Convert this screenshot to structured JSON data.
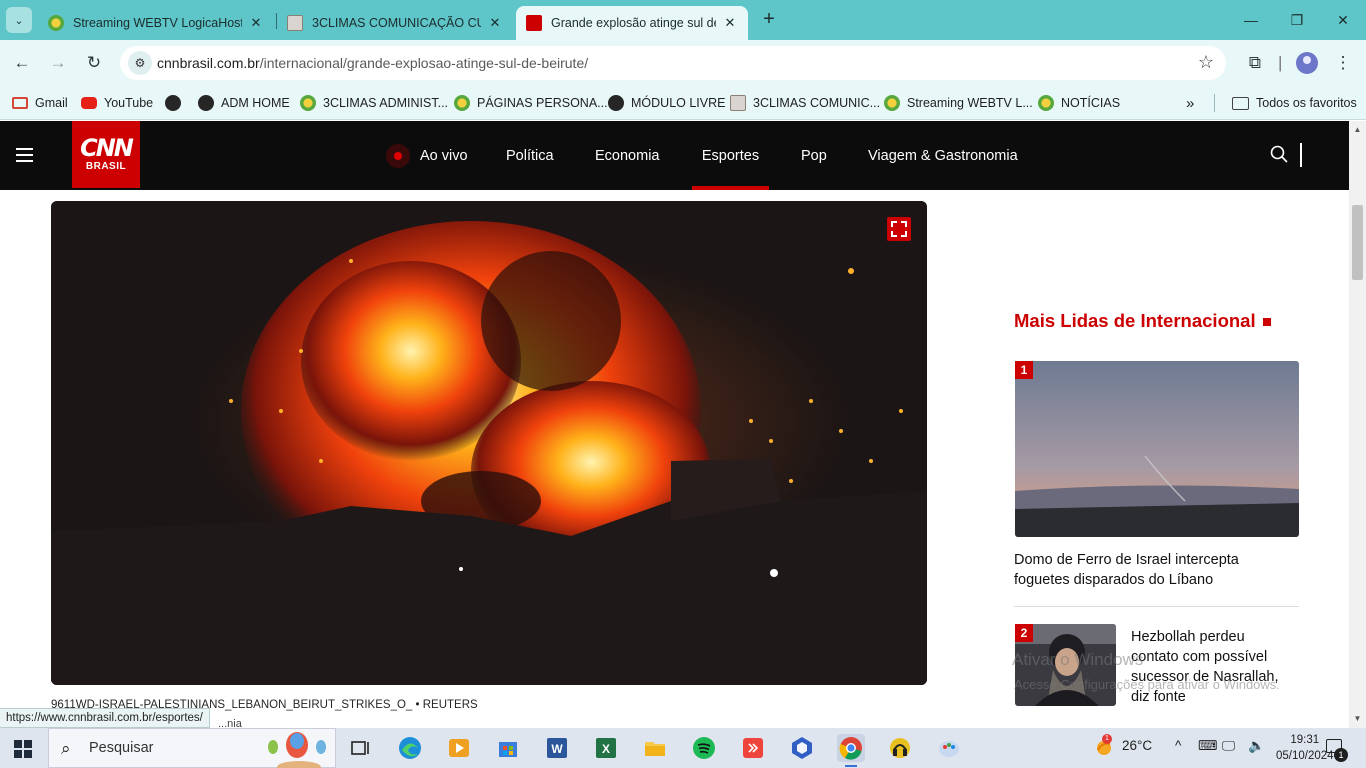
{
  "browser": {
    "tabs": [
      {
        "title": "Streaming WEBTV LogicaHost - ",
        "active": false
      },
      {
        "title": "3CLIMAS COMUNICAÇÃO CULT",
        "active": false
      },
      {
        "title": "Grande explosão atinge sul de ",
        "active": true
      }
    ],
    "address": {
      "domain": "cnnbrasil.com.br",
      "path": "/internacional/grande-explosao-atinge-sul-de-beirute/"
    },
    "bookmarks": [
      {
        "label": "Gmail",
        "icon": "gmail-icon"
      },
      {
        "label": "YouTube",
        "icon": "youtube-icon"
      },
      {
        "label": "",
        "icon": "globe-icon"
      },
      {
        "label": "ADM HOME",
        "icon": "globe-icon"
      },
      {
        "label": "3CLIMAS ADMINIST...",
        "icon": "sunflower-icon"
      },
      {
        "label": "PÁGINAS PERSONA...",
        "icon": "sunflower-icon"
      },
      {
        "label": "MÓDULO LIVRE",
        "icon": "globe-icon"
      },
      {
        "label": "3CLIMAS COMUNIC...",
        "icon": "document-icon"
      },
      {
        "label": "Streaming WEBTV L...",
        "icon": "sunflower-icon"
      },
      {
        "label": "NOTÍCIAS",
        "icon": "sunflower-icon"
      }
    ],
    "more_bookmarks": "»",
    "all_favorites": "Todos os favoritos",
    "status_url": "https://www.cnnbrasil.com.br/esportes/"
  },
  "site": {
    "logo_top": "CNN",
    "logo_bottom": "BRASIL",
    "nav": {
      "live": "Ao vivo",
      "items": [
        "Política",
        "Economia",
        "Esportes",
        "Pop",
        "Viagem & Gastronomia"
      ],
      "active": "Esportes"
    }
  },
  "article": {
    "caption_id": "9611WD-ISRAEL-PALESTINIANS_LEBANON_BEIRUT_STRIKES_O_",
    "caption_sep": "•",
    "caption_credit": "REUTERS",
    "under_caption": "...nia"
  },
  "sidebar": {
    "title": "Mais Lidas de Internacional",
    "items": [
      {
        "rank": "1",
        "title": "Domo de Ferro de Israel intercepta foguetes disparados do Líbano"
      },
      {
        "rank": "2",
        "title": "Hezbollah perdeu contato com possível sucessor de Nasrallah, diz fonte"
      }
    ]
  },
  "windows_watermark": {
    "line1": "Ativar o Windows",
    "line2": "Acesse Configurações para ativar o Windows."
  },
  "taskbar": {
    "search_placeholder": "Pesquisar",
    "weather": "26°C",
    "time": "19:31",
    "date": "05/10/2024",
    "notifications": "1"
  },
  "colors": {
    "brand_red": "#cc0000",
    "chrome_teal": "#5ec5c8",
    "chrome_light": "#e8f7f7"
  }
}
